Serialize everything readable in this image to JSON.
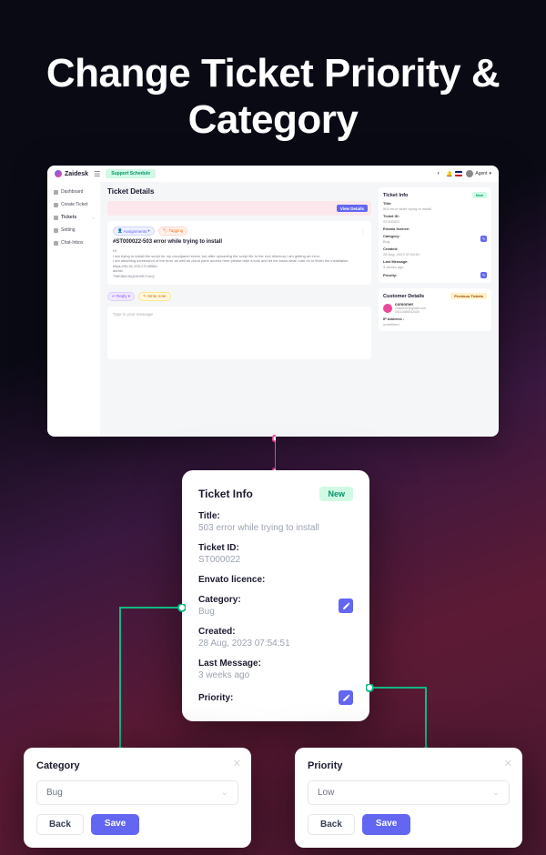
{
  "hero_title": "Change Ticket Priority & Category",
  "app": {
    "logo": "Zaidesk",
    "schedule_btn": "Support Schedule",
    "agent_label": "Agent",
    "sidebar": [
      {
        "label": "Dashboard"
      },
      {
        "label": "Create Ticket"
      },
      {
        "label": "Tickets"
      },
      {
        "label": "Setting"
      },
      {
        "label": "Chat-Inbox"
      }
    ],
    "page_title": "Ticket Details",
    "view_details": "View Details",
    "assign_tag": "Assignments",
    "tagging": "Tagging",
    "ticket_title": "#ST000022-503 error while trying to install",
    "ticket_hi": "Hi",
    "ticket_body1": "I am trying to install the script for my cloudpanel server but after uploading the script file to the root directory i am getting an error.",
    "ticket_body2": "I am attaching screenshot of the error as well as cloud pane access here please take a look and let me know what i can do to finish the installation.",
    "ticket_url": "https://95.91.225.170:8086/",
    "ticket_user": "admin",
    "ticket_key": "TNlK5bKJkQrDh9S7r1eQ",
    "reply": "Reply",
    "add_note": "Write note",
    "compose_placeholder": "Type in your message",
    "mini": {
      "title": "Ticket Info",
      "new": "New",
      "fields": {
        "title_l": "Title:",
        "title_v": "503 error while trying to install",
        "id_l": "Ticket ID:",
        "id_v": "ST000022",
        "env_l": "Envato licence:",
        "cat_l": "Category:",
        "cat_v": "Bug",
        "cr_l": "Created:",
        "cr_v": "28 Aug, 2023 07:54:51",
        "lm_l": "Last Message:",
        "lm_v": "3 weeks ago",
        "pr_l": "Priority:"
      }
    },
    "cust": {
      "title": "Customer Details",
      "prev": "Previous Tickets",
      "name": "comomer",
      "email": "customer@gmail.com",
      "phone": "00111085042434",
      "ip_l": "IP Address :",
      "ip_v": "undefined"
    }
  },
  "detail": {
    "title": "Ticket Info",
    "new": "New",
    "f": {
      "title_l": "Title:",
      "title_v": "503 error while trying to install",
      "id_l": "Ticket ID:",
      "id_v": "ST000022",
      "env_l": "Envato licence:",
      "cat_l": "Category:",
      "cat_v": "Bug",
      "cr_l": "Created:",
      "cr_v": "28 Aug, 2023 07:54:51",
      "lm_l": "Last Message:",
      "lm_v": "3 weeks ago",
      "pr_l": "Priority:"
    }
  },
  "modal_cat": {
    "title": "Category",
    "value": "Bug",
    "back": "Back",
    "save": "Save"
  },
  "modal_pri": {
    "title": "Priority",
    "value": "Low",
    "back": "Back",
    "save": "Save"
  }
}
